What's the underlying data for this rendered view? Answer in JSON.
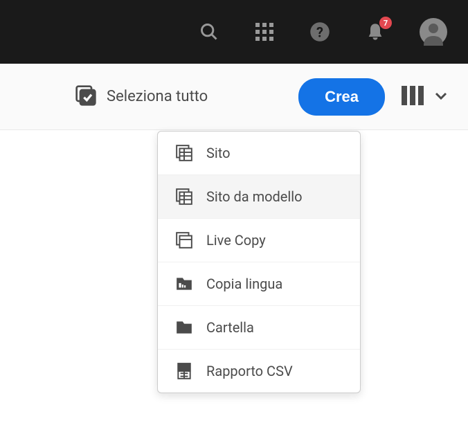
{
  "topbar": {
    "notification_count": "7"
  },
  "actionbar": {
    "select_all_label": "Seleziona tutto",
    "create_label": "Crea"
  },
  "dropdown": {
    "items": [
      {
        "label": "Sito"
      },
      {
        "label": "Sito da modello"
      },
      {
        "label": "Live Copy"
      },
      {
        "label": "Copia lingua"
      },
      {
        "label": "Cartella"
      },
      {
        "label": "Rapporto CSV"
      }
    ]
  }
}
